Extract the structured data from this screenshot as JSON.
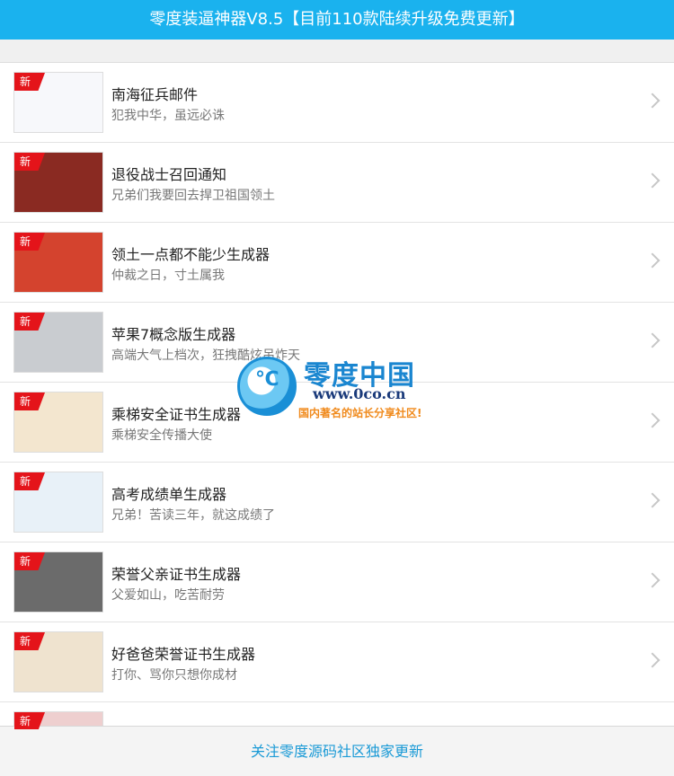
{
  "header": {
    "title": "零度装逼神器V8.5【目前110款陆续升级免费更新】"
  },
  "badge_label": "新",
  "items": [
    {
      "title": "南海征兵邮件",
      "subtitle": "犯我中华，虽远必诛",
      "thumb_color": "#f7f8fb"
    },
    {
      "title": "退役战士召回通知",
      "subtitle": "兄弟们我要回去捍卫祖国领土",
      "thumb_color": "#8a2a22"
    },
    {
      "title": "领土一点都不能少生成器",
      "subtitle": "仲裁之日，寸土属我",
      "thumb_color": "#d4432e"
    },
    {
      "title": "苹果7概念版生成器",
      "subtitle": "高端大气上档次，狂拽酷炫吊炸天",
      "thumb_color": "#c9ccd0"
    },
    {
      "title": "乘梯安全证书生成器",
      "subtitle": "乘梯安全传播大使",
      "thumb_color": "#f3e6cf"
    },
    {
      "title": "高考成绩单生成器",
      "subtitle": "兄弟！苦读三年，就这成绩了",
      "thumb_color": "#e8f1f8"
    },
    {
      "title": "荣誉父亲证书生成器",
      "subtitle": "父爱如山，吃苦耐劳",
      "thumb_color": "#6b6b6b"
    },
    {
      "title": "好爸爸荣誉证书生成器",
      "subtitle": "打你、骂你只想你成材",
      "thumb_color": "#efe3cf"
    }
  ],
  "partial_item": {
    "thumb_color": "#eecfcf"
  },
  "footer": {
    "label": "关注零度源码社区独家更新"
  },
  "watermark": {
    "name": "零度中国",
    "url": "www.0co.cn",
    "tagline": "国内著名的站长分享社区!",
    "symbol": "℃"
  }
}
